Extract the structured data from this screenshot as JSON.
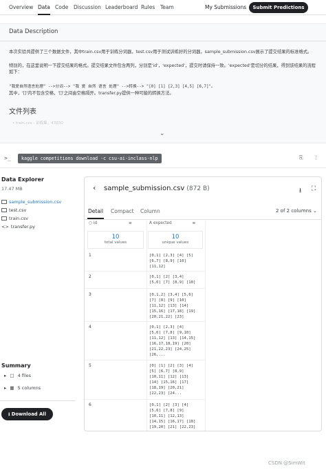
{
  "nav": {
    "tabs": [
      "Overview",
      "Data",
      "Code",
      "Discussion",
      "Leaderboard",
      "Rules",
      "Team"
    ],
    "my_submissions": "My Submissions",
    "submit": "Submit Predictions"
  },
  "description": {
    "title": "Data Description",
    "para1": "本次实验共提供了三个数据文件，其中train.csv用于训练分词器，test.csv用于测试训练好的分词器，sample_submission.csv展示了提交结果的标准格式。",
    "para2": "特别的，在这里说明一下提交结果的格式。提交结果文件包含两列，分别是'id'，'expected'，提交时请保持一致。'expected'是切分的结果，得到该结果的流程如下：",
    "code": "\"我爱自然语言处理\" -->分词--> \"我 爱 自然 语言 处理\" -->转换--> \"[0] [1] [2,3] [4,5] [6,7]\"。",
    "para3": "其中，'[]'内不包含空格，'[]'之间由空格隔开。transfer.py提供一种可能的转换方法。",
    "heading": "文件列表",
    "faded_item": "• train.csv - 训练集，47030"
  },
  "command": {
    "text": "kaggle competitions download -c csu-ai-inclass-nlp"
  },
  "explorer": {
    "title": "Data Explorer",
    "size": "17.47 MB",
    "files": [
      "sample_submission.csv",
      "test.csv",
      "train.csv",
      "transfer.py"
    ]
  },
  "summary": {
    "title": "Summary",
    "files": "4 files",
    "columns": "5 columns"
  },
  "download_all": "Download All",
  "viewer": {
    "filename": "sample_submission.csv",
    "filesize": "(872 B)",
    "tabs": [
      "Detail",
      "Compact",
      "Column"
    ],
    "column_count": "2 of 2 columns",
    "columns": [
      {
        "name": "id",
        "stat_value": "10",
        "stat_label": "total values"
      },
      {
        "name": "expected",
        "stat_value": "10",
        "stat_label": "unique values"
      }
    ],
    "rows": [
      {
        "id": "1",
        "expected": "[0,1] [2,3] [4] [5]\n[6,7] [8,9] [10]\n[11,12]"
      },
      {
        "id": "2",
        "expected": "[0,1] [2] [3,4]\n[5,6] [7] [8,9] [10]"
      },
      {
        "id": "3",
        "expected": "[0,1,2] [3,4] [5,6]\n[7] [8] [9] [10]\n[11,12] [13] [14]\n[15,16] [17,18] [19]\n[20,21,22] [23]"
      },
      {
        "id": "4",
        "expected": "[0,1] [2,3] [4]\n[5,6] [7,8] [9,10]\n[11,12] [13] [14,15]\n[16,17,18,19] [20]\n[21,22,23] [24,25]\n[26,..."
      },
      {
        "id": "5",
        "expected": "[0] [1] [2] [3] [4]\n[5] [6,7] [8,9]\n[10,11] [12] [13]\n[14] [15,16] [17]\n[18,19] [20,21]\n[22,23] [24..."
      },
      {
        "id": "6",
        "expected": "[0,1] [2] [3] [4]\n[5,6] [7,8] [9]\n[10,11] [12,13]\n[14,15] [16,17] [18]\n[19,20] [21] [22,23]\n[24]"
      }
    ]
  },
  "watermark": "CSDN @SimWit"
}
